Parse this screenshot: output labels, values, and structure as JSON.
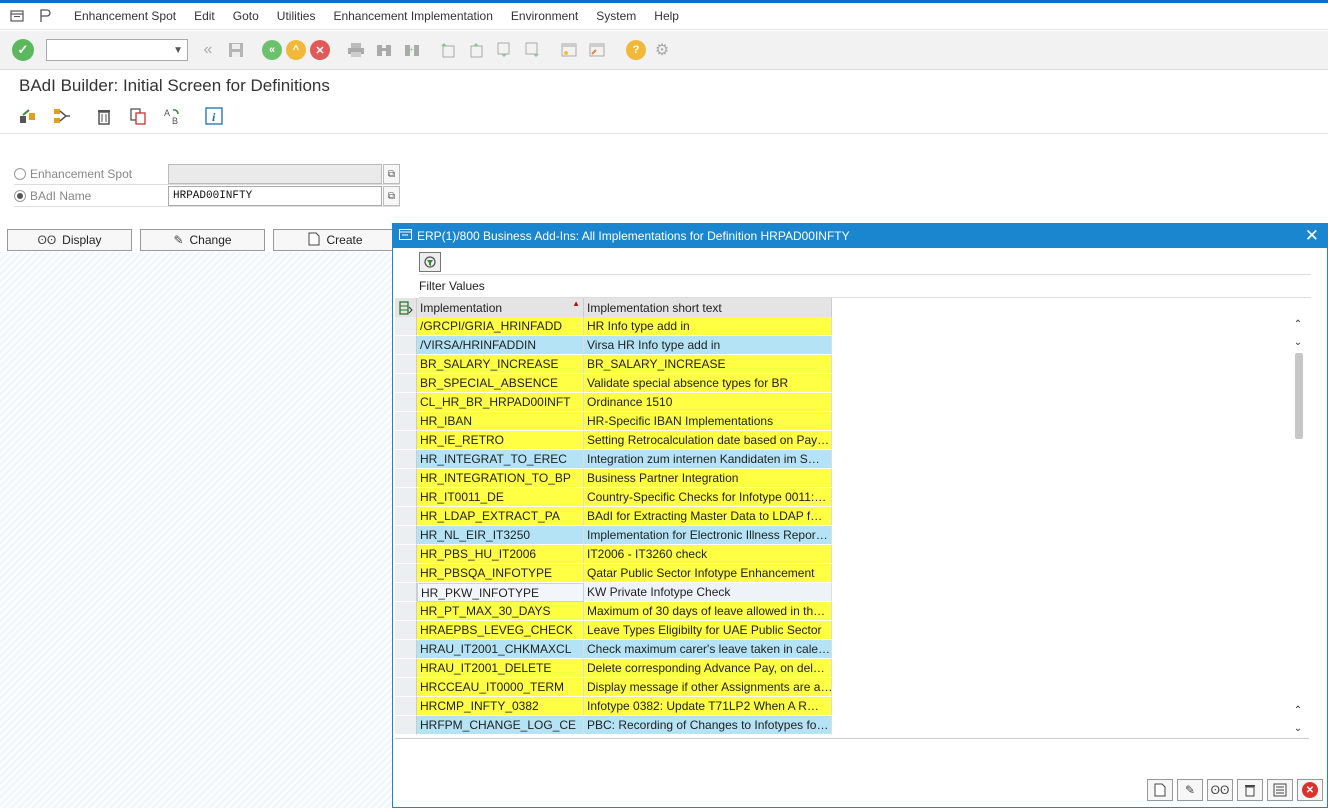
{
  "menu": {
    "items": [
      "Enhancement Spot",
      "Edit",
      "Goto",
      "Utilities",
      "Enhancement Implementation",
      "Environment",
      "System",
      "Help"
    ]
  },
  "standard_toolbar": {
    "command_field_value": ""
  },
  "page_title": "BAdI Builder: Initial Screen for Definitions",
  "form": {
    "enhancement_spot_label": "Enhancement Spot",
    "enhancement_spot_value": "",
    "badi_name_label": "BAdI Name",
    "badi_name_value": "HRPAD00INFTY",
    "selected_option": "BAdI Name"
  },
  "buttons": {
    "display": "Display",
    "change": "Change",
    "create": "Create"
  },
  "popup": {
    "title": "ERP(1)/800 Business Add-Ins: All Implementations for Definition HRPAD00INFTY",
    "filter_label": "Filter Values",
    "columns": [
      "Implementation",
      "Implementation short text"
    ],
    "rows": [
      {
        "impl": "/GRCPI/GRIA_HRINFADD",
        "text": "HR Info type add in",
        "color": "yellow"
      },
      {
        "impl": "/VIRSA/HRINFADDIN",
        "text": "Virsa HR Info type add in",
        "color": "blue"
      },
      {
        "impl": "BR_SALARY_INCREASE",
        "text": "BR_SALARY_INCREASE",
        "color": "yellow"
      },
      {
        "impl": "BR_SPECIAL_ABSENCE",
        "text": "Validate special absence types for BR",
        "color": "yellow"
      },
      {
        "impl": "CL_HR_BR_HRPAD00INFT",
        "text": "Ordinance 1510",
        "color": "yellow"
      },
      {
        "impl": "HR_IBAN",
        "text": "HR-Specific IBAN Implementations",
        "color": "yellow"
      },
      {
        "impl": "HR_IE_RETRO",
        "text": "Setting Retrocalculation date based on Pay…",
        "color": "yellow"
      },
      {
        "impl": "HR_INTEGRAT_TO_EREC",
        "text": "Integration zum internen Kandidaten im S…",
        "color": "blue"
      },
      {
        "impl": "HR_INTEGRATION_TO_BP",
        "text": "Business Partner Integration",
        "color": "yellow"
      },
      {
        "impl": "HR_IT0011_DE",
        "text": "Country-Specific Checks for Infotype 0011:…",
        "color": "yellow"
      },
      {
        "impl": "HR_LDAP_EXTRACT_PA",
        "text": "BAdI for Extracting Master Data to LDAP f…",
        "color": "yellow"
      },
      {
        "impl": "HR_NL_EIR_IT3250",
        "text": "Implementation for Electronic Illness Repor…",
        "color": "blue"
      },
      {
        "impl": "HR_PBS_HU_IT2006",
        "text": "IT2006 - IT3260 check",
        "color": "yellow"
      },
      {
        "impl": "HR_PBSQA_INFOTYPE",
        "text": "Qatar Public Sector Infotype Enhancement",
        "color": "yellow"
      },
      {
        "impl": "HR_PKW_INFOTYPE",
        "text": "KW Private Infotype Check",
        "color": "white"
      },
      {
        "impl": "HR_PT_MAX_30_DAYS",
        "text": "Maximum of 30 days of leave allowed in th…",
        "color": "yellow"
      },
      {
        "impl": "HRAEPBS_LEVEG_CHECK",
        "text": "Leave Types Eligibilty for UAE Public Sector",
        "color": "yellow"
      },
      {
        "impl": "HRAU_IT2001_CHKMAXCL",
        "text": "Check maximum carer's leave taken in cale…",
        "color": "blue"
      },
      {
        "impl": "HRAU_IT2001_DELETE",
        "text": "Delete corresponding Advance Pay, on del…",
        "color": "yellow"
      },
      {
        "impl": "HRCCEAU_IT0000_TERM",
        "text": "Display message if other Assignments are a…",
        "color": "yellow"
      },
      {
        "impl": "HRCMP_INFTY_0382",
        "text": "Infotype 0382: Update T71LP2 When A R…",
        "color": "yellow"
      },
      {
        "impl": "HRFPM_CHANGE_LOG_CE",
        "text": "PBC: Recording of Changes to Infotypes fo…",
        "color": "blue"
      }
    ]
  },
  "colors": {
    "title_bar": "#1a86d0",
    "row_yellow": "#ffff44",
    "row_blue": "#b3e3f4",
    "ok_green": "#5cb85c",
    "cancel_red": "#d9342b"
  }
}
